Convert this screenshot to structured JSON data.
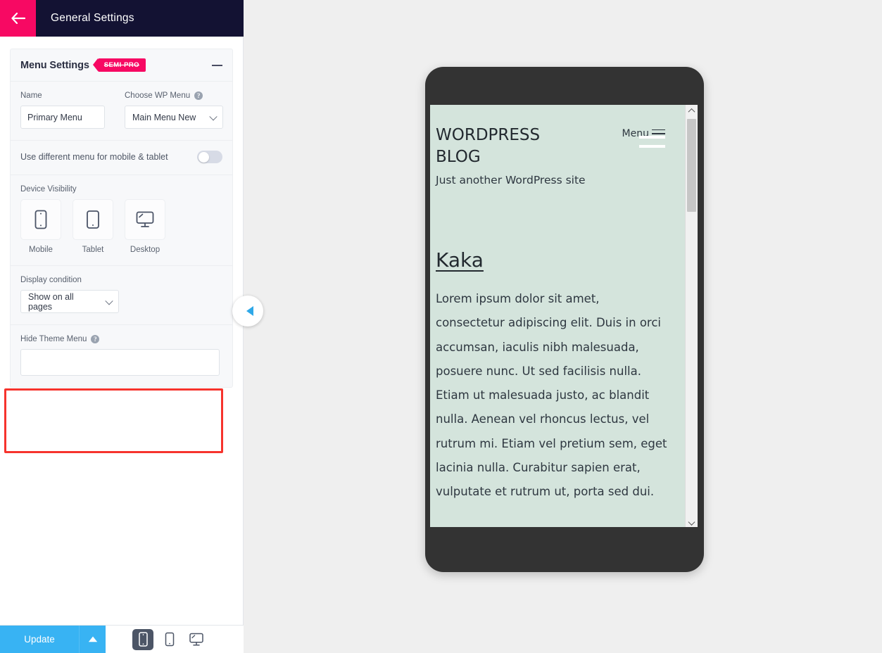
{
  "header": {
    "title": "General Settings",
    "back_icon": "arrow-left-icon",
    "accent_pink": "#f70963",
    "bar_color": "#131233"
  },
  "card": {
    "title": "Menu Settings",
    "badge": "SEMI-PRO",
    "collapse_icon": "minus-icon"
  },
  "fields": {
    "name_label": "Name",
    "name_value": "Primary Menu",
    "wp_menu_label": "Choose WP Menu",
    "wp_menu_help": "?",
    "wp_menu_value": "Main Menu New",
    "toggle_label": "Use different menu for mobile & tablet",
    "toggle_state": "off",
    "device_visibility_label": "Device Visibility",
    "devices": [
      {
        "label": "Mobile",
        "icon": "mobile-icon"
      },
      {
        "label": "Tablet",
        "icon": "tablet-icon"
      },
      {
        "label": "Desktop",
        "icon": "desktop-icon"
      }
    ],
    "display_condition_label": "Display condition",
    "display_condition_value": "Show on all pages",
    "hide_theme_menu_label": "Hide Theme Menu",
    "hide_theme_menu_help": "?",
    "hide_theme_menu_value": ""
  },
  "footer": {
    "update_label": "Update",
    "caret_icon": "triangle-up-icon",
    "devices": [
      {
        "name": "mobile",
        "icon": "mobile-icon",
        "active": true
      },
      {
        "name": "tablet",
        "icon": "tablet-icon",
        "active": false
      },
      {
        "name": "desktop",
        "icon": "desktop-icon",
        "active": false
      }
    ]
  },
  "preview": {
    "collapse_icon": "triangle-left-icon",
    "site_title": "WORDPRESS BLOG",
    "site_tagline": "Just another WordPress site",
    "menu_label": "Menu",
    "menu_icon": "hamburger-icon",
    "post_title": "Kaka",
    "post_body": "Lorem ipsum dolor sit amet, consectetur adipiscing elit. Duis in orci accumsan, iaculis nibh malesuada, posuere nunc. Ut sed facilisis nulla. Etiam ut malesuada justo, ac blandit nulla. Aenean vel rhoncus lectus, vel rutrum mi. Etiam vel pretium sem, eget lacinia nulla. Curabitur sapien erat, vulputate et rutrum ut, porta sed dui.",
    "background_color": "#d4e4dc",
    "frame_color": "#333333"
  }
}
